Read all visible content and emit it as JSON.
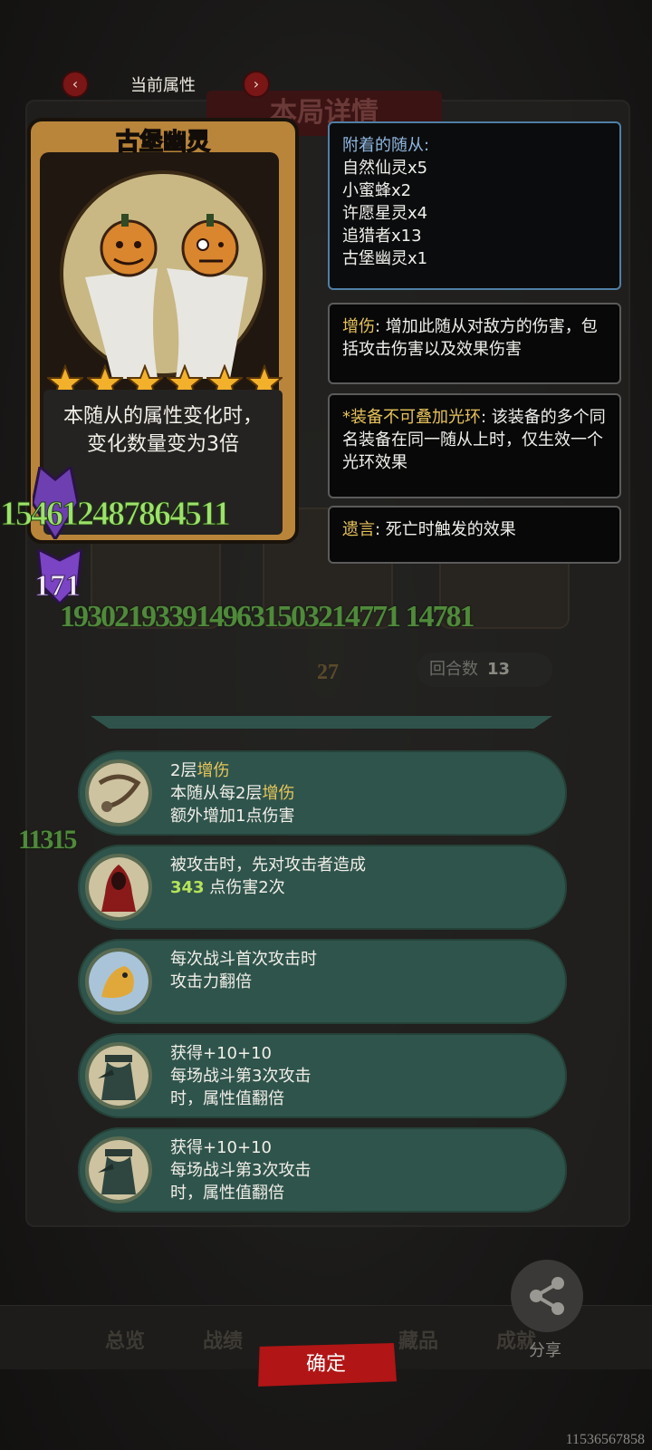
{
  "header": {
    "title": "当前属性",
    "prev_icon": "chevron-left-icon",
    "next_icon": "chevron-right-icon",
    "bg_title": "本局详情"
  },
  "card": {
    "name": "古堡幽灵",
    "stars": 6,
    "description": "本随从的属性变化时，变化数量变为3倍"
  },
  "overlay_numbers": {
    "big_green": "154612487864511",
    "purple_value": "171",
    "row_green": "1930219339149631503214771 14781",
    "left_green": "11315"
  },
  "arrow_count": "27",
  "round": {
    "label": "回合数",
    "value": "13"
  },
  "panels": {
    "attached_title": "附着的随从:",
    "attached": [
      "自然仙灵x5",
      "小蜜蜂x2",
      "许愿星灵x4",
      "追猎者x13",
      "古堡幽灵x1"
    ],
    "damage_key": "增伤",
    "damage_text": ": 增加此随从对敌方的伤害，包括攻击伤害以及效果伤害",
    "aura_key": "*装备不可叠加光环",
    "aura_text": ": 该装备的多个同名装备在同一随从上时，仅生效一个光环效果",
    "deathrattle_key": "遗言",
    "deathrattle_text": ": 死亡时触发的效果"
  },
  "buffs": [
    {
      "icon": "rope-icon",
      "line1a": "2层",
      "line1b": "增伤",
      "line2a": "本随从每2层",
      "line2b": "增伤",
      "line3": "额外增加1点伤害"
    },
    {
      "icon": "red-cloak-icon",
      "line1": "被攻击时，先对攻击者造成",
      "dmg": "343",
      "line2": " 点伤害2次"
    },
    {
      "icon": "dragon-icon",
      "line1": "每次战斗首次攻击时",
      "line2": "攻击力翻倍"
    },
    {
      "icon": "plague-doctor-icon",
      "line1": "获得+10+10",
      "line2": "每场战斗第3次攻击",
      "line3": "时，属性值翻倍"
    },
    {
      "icon": "plague-doctor-icon",
      "line1": "获得+10+10",
      "line2": "每场战斗第3次攻击",
      "line3": "时，属性值翻倍"
    }
  ],
  "bottom": {
    "tabs": [
      "总览",
      "战绩",
      "藏品",
      "成就"
    ],
    "confirm": "确定",
    "share": "分享",
    "id": "11536567858"
  }
}
